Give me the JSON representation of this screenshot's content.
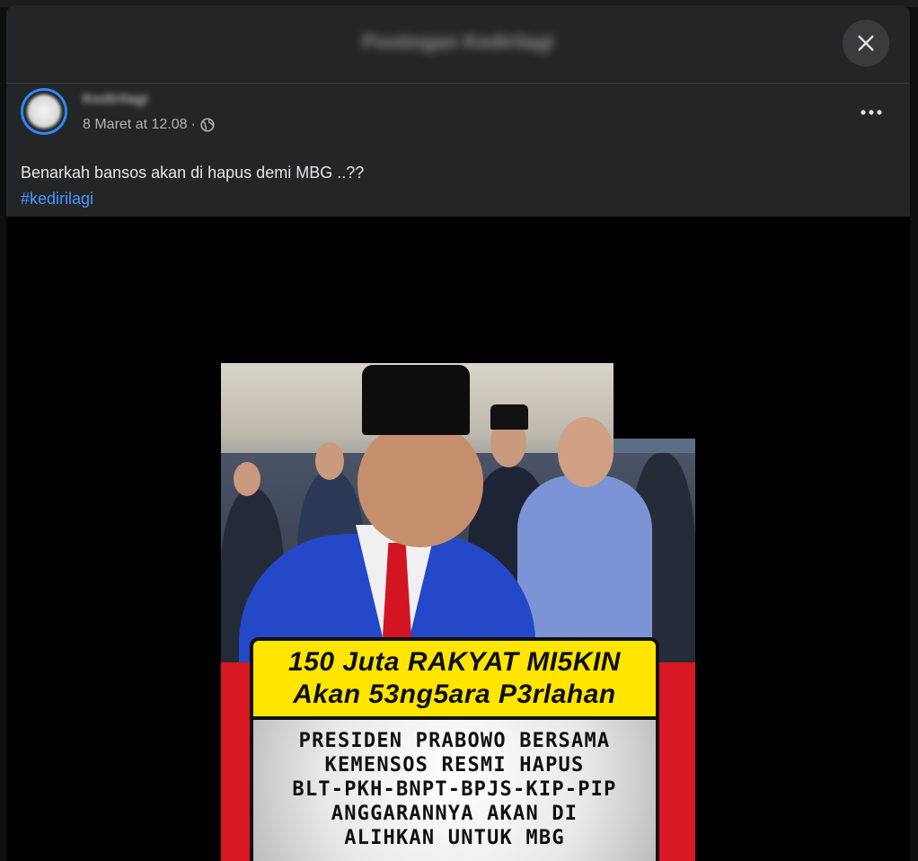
{
  "modal": {
    "title": "Postingan Kedirilagi"
  },
  "post": {
    "author": "Kedirilagi",
    "timestamp": "8 Maret at 12.08",
    "separator": "·",
    "privacy_icon": "globe-icon",
    "text": "Benarkah bansos akan di hapus demi MBG ..??",
    "hashtag": "#kedirilagi"
  },
  "image": {
    "headline_line1": "150 Juta RAKYAT MI5KIN",
    "headline_line2": "Akan 53ng5ara P3rlahan",
    "body_lines": [
      "PRESIDEN PRABOWO BERSAMA",
      "KEMENSOS RESMI HAPUS",
      "BLT-PKH-BNPT-BPJS-KIP-PIP",
      "ANGGARANNYA AKAN DI",
      "ALIHKAN UNTUK MBG"
    ]
  },
  "colors": {
    "modal_bg": "#242526",
    "link": "#4599ff",
    "headline_bg": "#ffe500",
    "accent_red": "#d81822"
  }
}
